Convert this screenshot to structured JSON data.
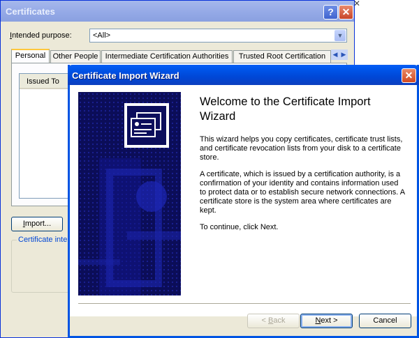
{
  "certificates_window": {
    "title": "Certificates",
    "help_button": "?",
    "close_button": "✕",
    "intended_purpose_label": "ntended purpose:",
    "intended_purpose_access": "I",
    "intended_purpose_value": "<All>",
    "tabs": [
      {
        "label": "Personal",
        "active": true
      },
      {
        "label": "Other People",
        "active": false
      },
      {
        "label": "Intermediate Certification Authorities",
        "active": false
      },
      {
        "label": "Trusted Root Certification",
        "active": false
      }
    ],
    "list_columns": [
      "Issued To"
    ],
    "import_button_access": "I",
    "import_button_rest": "mport...",
    "purposes_group_label": "Certificate inter"
  },
  "wizard": {
    "title": "Certificate Import Wizard",
    "close_button": "✕",
    "heading": "Welcome to the Certificate Import Wizard",
    "paragraph1": "This wizard helps you copy certificates, certificate trust lists, and certificate revocation lists from your disk to a certificate store.",
    "paragraph2": "A certificate, which is issued by a certification authority, is a confirmation of your identity and contains information used to protect data or to establish secure network connections. A certificate store is the system area where certificates are kept.",
    "paragraph3": "To continue, click Next.",
    "back_button_prefix": "< ",
    "back_button_access": "B",
    "back_button_rest": "ack",
    "next_button_access": "N",
    "next_button_rest": "ext >",
    "cancel_button": "Cancel"
  },
  "icons": {
    "wizard_banner_icon": "certificate-icon",
    "dropdown_arrow": "chevron-down-icon",
    "tab_scroll_left": "chevron-left-icon",
    "tab_scroll_right": "chevron-right-icon"
  },
  "colors": {
    "xp_blue_title": "#0058ee",
    "banner_navy": "#0c0e5c",
    "inactive_title": "#93a8e6",
    "dialog_face": "#ece9d8"
  }
}
